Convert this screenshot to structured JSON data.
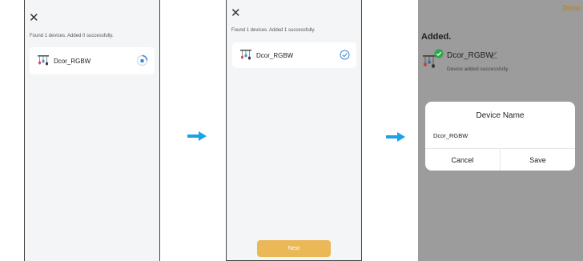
{
  "colors": {
    "accent_orange": "#ebb857",
    "done_orange": "#b8862c",
    "arrow_blue": "#1aa3e8",
    "check_green": "#2ea84a",
    "check_blue": "#3a86d6",
    "overlay_gray": "#9c9c9c"
  },
  "screen1": {
    "close_icon": "close-icon",
    "status_text": "Found 1 devices. Added 0 successfully.",
    "device_name": "Dcor_RGBW",
    "device_icon": "light-fixture-icon",
    "status_icon": "loading-spinner-icon"
  },
  "screen2": {
    "close_icon": "close-icon",
    "status_text": "Found 1 devices. Added 1 successfully.",
    "device_name": "Dcor_RGBW",
    "device_icon": "light-fixture-icon",
    "status_icon": "check-circle-icon",
    "next_label": "Next"
  },
  "screen3": {
    "done_label": "Done",
    "title": "Added.",
    "device_name": "Dcor_RGBW",
    "device_sub": "Device added successfully",
    "dialog": {
      "title": "Device Name",
      "value": "Dcor_RGBW",
      "cancel_label": "Cancel",
      "save_label": "Save"
    }
  }
}
